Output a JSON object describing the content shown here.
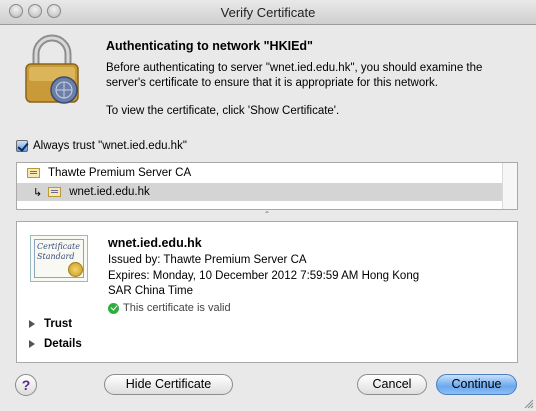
{
  "window": {
    "title": "Verify Certificate"
  },
  "message": {
    "heading": "Authenticating to network \"HKIEd\"",
    "paragraph1": "Before authenticating to server \"wnet.ied.edu.hk\", you should examine the server's certificate to ensure that it is appropriate for this network.",
    "paragraph2": "To view the certificate, click 'Show Certificate'."
  },
  "trust_checkbox": {
    "label": "Always trust \"wnet.ied.edu.hk\"",
    "checked": true
  },
  "cert_tree": {
    "root": "Thawte Premium Server CA",
    "child": "wnet.ied.edu.hk",
    "child_arrow": "↳"
  },
  "cert_detail": {
    "badge_text": "Certificate Standard",
    "common_name": "wnet.ied.edu.hk",
    "issuer": "Issued by: Thawte Premium Server CA",
    "expires": "Expires: Monday, 10 December 2012 7:59:59 AM Hong Kong SAR China Time",
    "status": "This certificate is valid",
    "status_color": "#2fae3f",
    "sections": [
      "Trust",
      "Details"
    ]
  },
  "buttons": {
    "help": "?",
    "hide_certificate": "Hide Certificate",
    "cancel": "Cancel",
    "continue": "Continue"
  },
  "colors": {
    "default_button": "#6aa8ee",
    "selection_row": "#d4d4d4"
  }
}
